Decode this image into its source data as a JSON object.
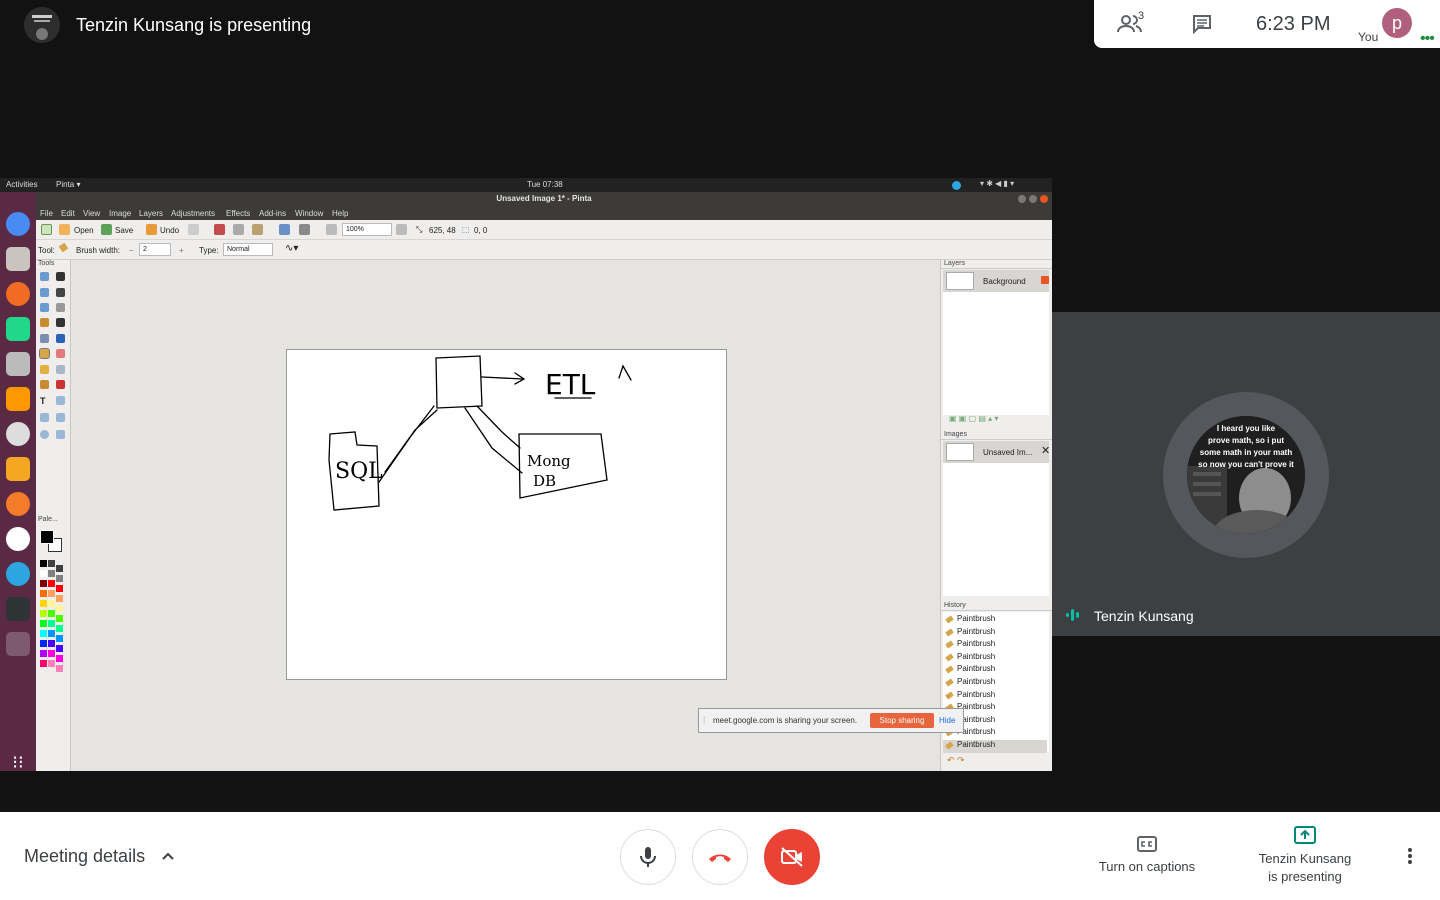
{
  "meet": {
    "presenter_title": "Tenzin Kunsang is presenting",
    "people_count": "3",
    "clock": "6:23 PM",
    "you_label": "You",
    "you_initial": "p",
    "tile_name": "Tenzin Kunsang",
    "avatar_caption_lines": [
      "I heard you like",
      "prove math, so i put",
      "some math in your math",
      "so now you can't prove it"
    ],
    "meeting_details_label": "Meeting details",
    "captions_label": "Turn on captions",
    "presenting_label_line1": "Tenzin Kunsang",
    "presenting_label_line2": "is presenting",
    "colors": {
      "green": "#1e8e3e",
      "red": "#ea4335",
      "teal": "#00897b"
    }
  },
  "shared_screen": {
    "gnome": {
      "activities": "Activities",
      "app_menu": "Pinta ▾",
      "clock": "Tue 07:38"
    },
    "window_title": "Unsaved Image 1* - Pinta",
    "menu": [
      "File",
      "Edit",
      "View",
      "Image",
      "Layers",
      "Adjustments",
      "Effects",
      "Add-ins",
      "Window",
      "Help"
    ],
    "toolbar": {
      "open": "Open",
      "save": "Save",
      "undo": "Undo",
      "zoom": "100%",
      "cursor_pos": "625, 48",
      "selection_size": "0, 0"
    },
    "toolbar2": {
      "tool_label": "Tool:",
      "brush_width_label": "Brush width:",
      "brush_width": "2",
      "type_label": "Type:",
      "type_value": "Normal"
    },
    "panels": {
      "tools": "Tools",
      "palette": "Pale...",
      "layers": "Layers",
      "layer_name": "Background",
      "images": "Images",
      "image_name": "Unsaved Im...",
      "history": "History"
    },
    "history_items": [
      "Paintbrush",
      "Paintbrush",
      "Paintbrush",
      "Paintbrush",
      "Paintbrush",
      "Paintbrush",
      "Paintbrush",
      "Paintbrush",
      "Paintbrush",
      "Paintbrush",
      "Paintbrush"
    ],
    "sketch_labels": {
      "left_box": "SQL",
      "right_box_line1": "Mong",
      "right_box_line2": "DB",
      "arrow_label": "ETL"
    },
    "share_notice": "meet.google.com is sharing your screen.",
    "stop_sharing": "Stop sharing",
    "hide": "Hide"
  }
}
